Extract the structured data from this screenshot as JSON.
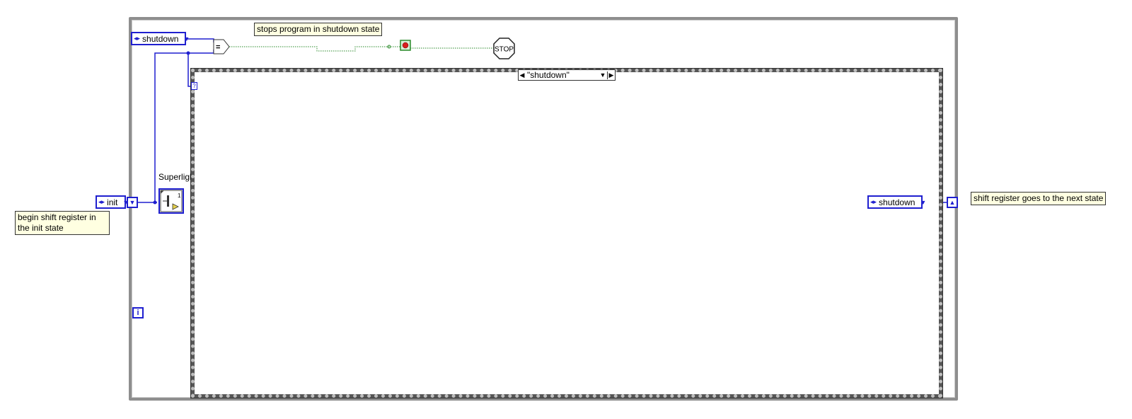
{
  "enum_shutdown_top": {
    "value": "shutdown"
  },
  "enum_init": {
    "value": "init"
  },
  "enum_shutdown_right": {
    "value": "shutdown"
  },
  "comments": {
    "stop": "stops program in shutdown state",
    "begin": "begin shift register in the init state",
    "next": "shift register goes to the next state"
  },
  "case_selector": {
    "label": "\"shutdown\""
  },
  "subvi": {
    "label": "Superlight",
    "number": "1"
  },
  "stop_terminal": {
    "label": "STOP"
  },
  "iteration_terminal": {
    "label": "i"
  },
  "selector_terminal": {
    "label": "?"
  },
  "colors": {
    "enum_wire": "#1f1fcf",
    "bool_wire": "#2a8a2a",
    "loop_frame": "#8e8e8e"
  }
}
